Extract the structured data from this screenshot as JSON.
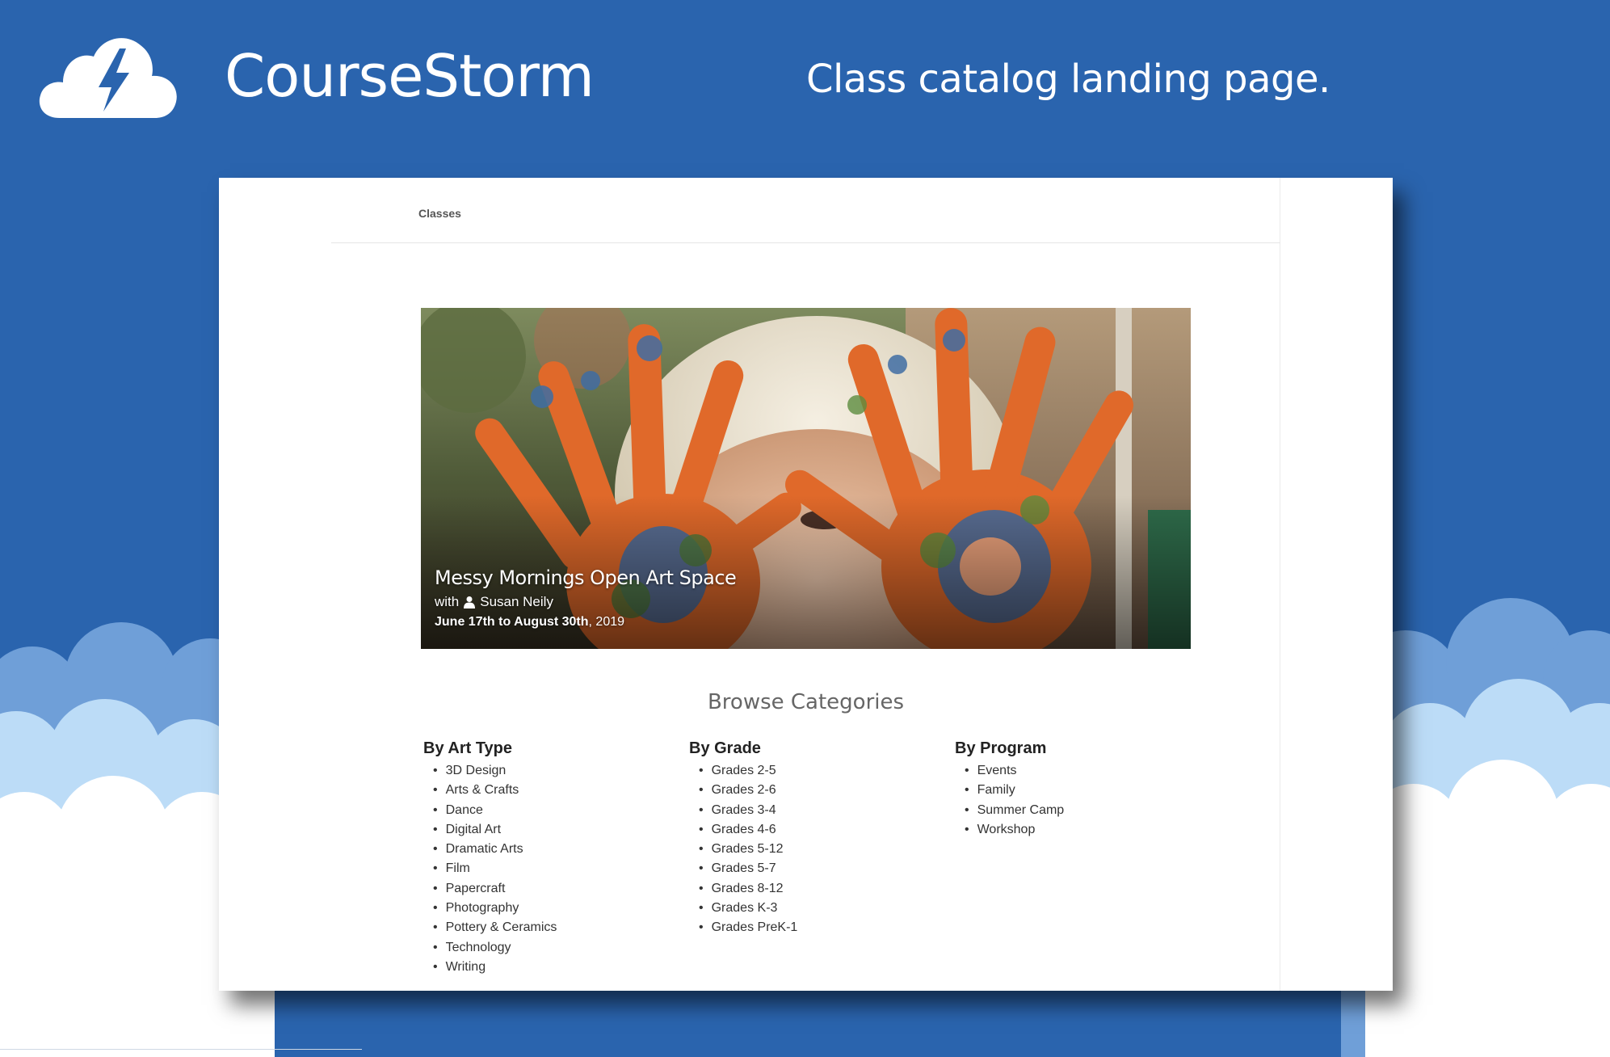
{
  "brand": {
    "name": "CourseStorm",
    "tagline": "Class catalog landing page."
  },
  "colors": {
    "background": "#2a64ae",
    "cloud_back": "#6f9fd8",
    "cloud_mid": "#bcdcf7",
    "cloud_front": "#ffffff"
  },
  "nav": {
    "classes_label": "Classes"
  },
  "hero": {
    "title": "Messy Mornings Open Art Space",
    "instructor_prefix": "with",
    "instructor_name": "Susan Neily",
    "instructor_icon": "person-icon",
    "dates_bold": "June 17th to August 30th",
    "dates_rest": ", 2019"
  },
  "browse": {
    "title": "Browse Categories",
    "columns": [
      {
        "heading": "By Art Type",
        "items": [
          "3D Design",
          "Arts & Crafts",
          "Dance",
          "Digital Art",
          "Dramatic Arts",
          "Film",
          "Papercraft",
          "Photography",
          "Pottery & Ceramics",
          "Technology",
          "Writing"
        ]
      },
      {
        "heading": "By Grade",
        "items": [
          "Grades 2-5",
          "Grades 2-6",
          "Grades 3-4",
          "Grades 4-6",
          "Grades 5-12",
          "Grades 5-7",
          "Grades 8-12",
          "Grades K-3",
          "Grades PreK-1"
        ]
      },
      {
        "heading": "By Program",
        "items": [
          "Events",
          "Family",
          "Summer Camp",
          "Workshop"
        ]
      }
    ]
  }
}
